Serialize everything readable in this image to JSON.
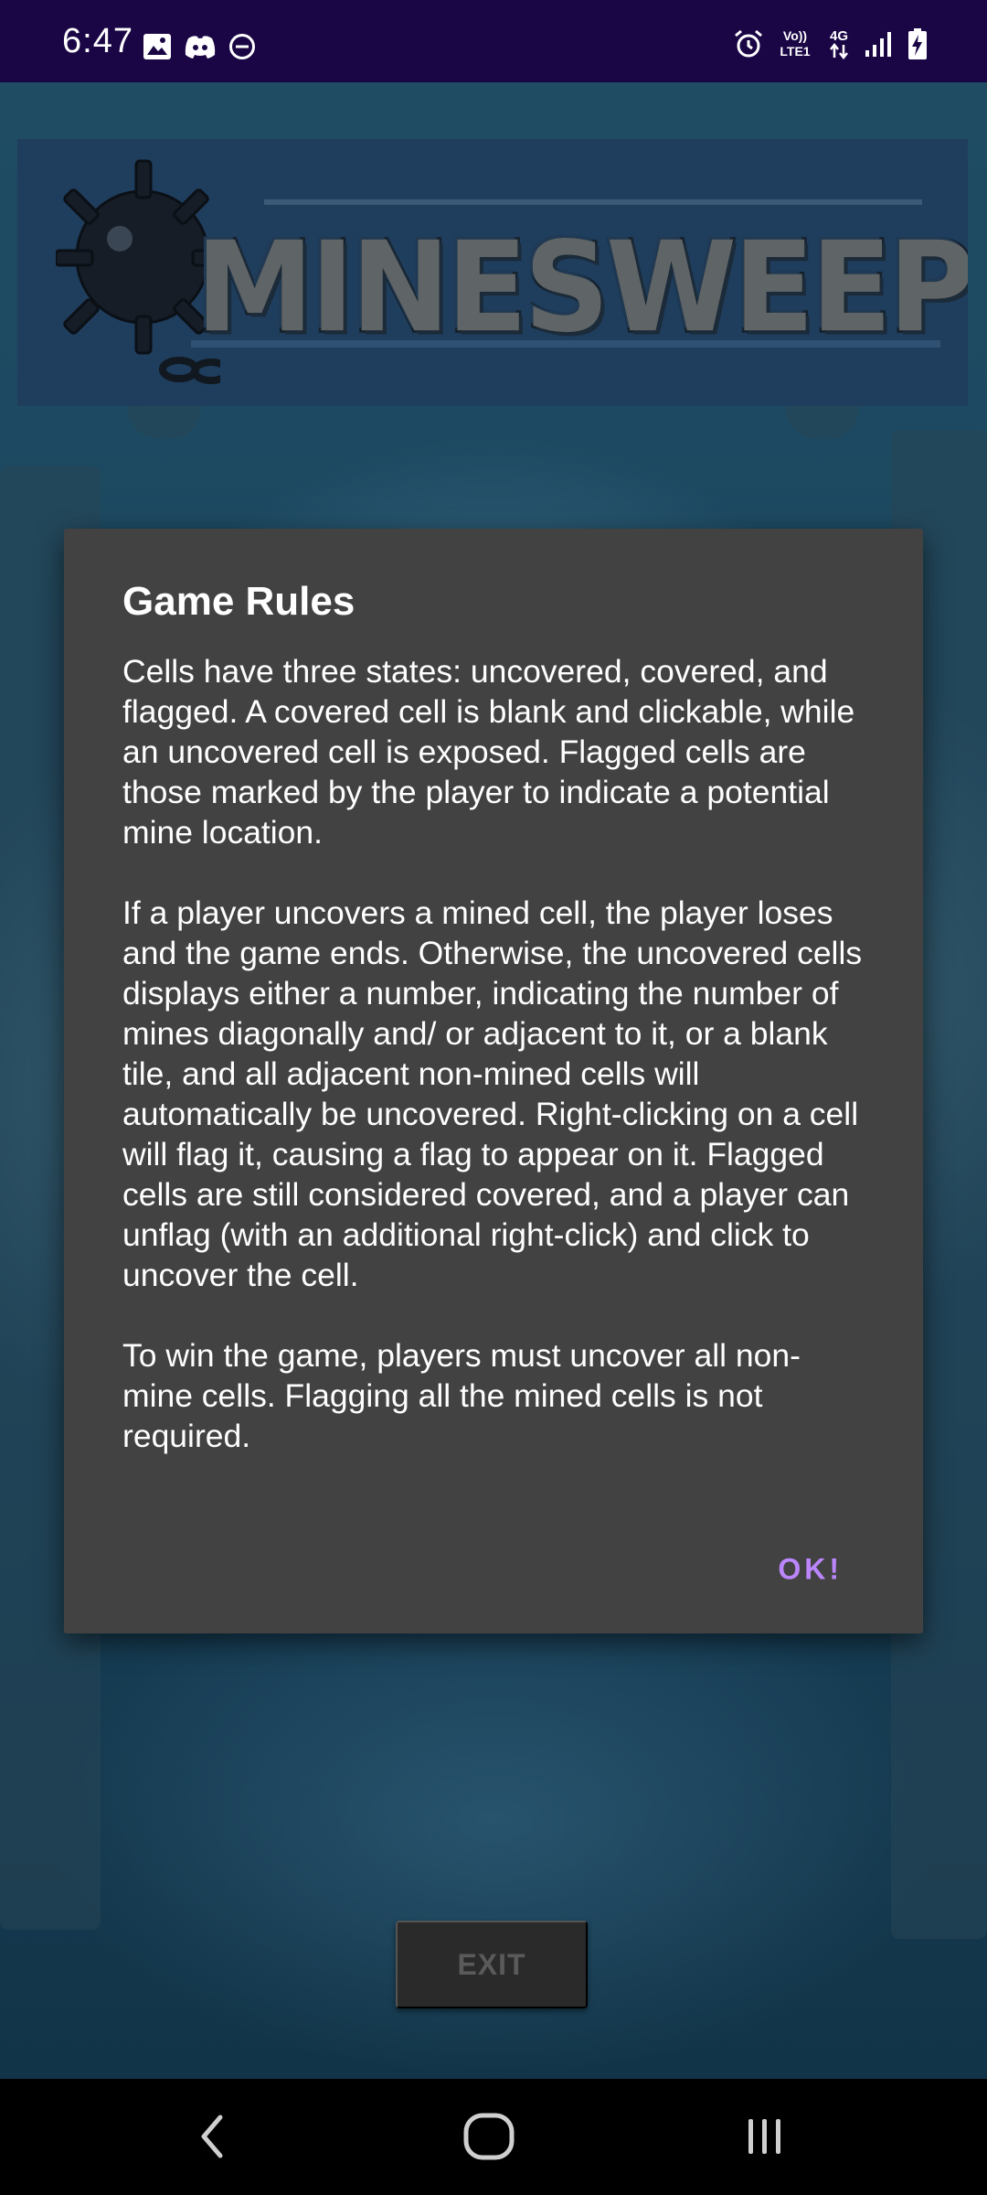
{
  "status_bar": {
    "time": "6:47",
    "left_icons": [
      "gallery-icon",
      "discord-icon",
      "do-not-disturb-icon"
    ],
    "right_icons": [
      "alarm-icon",
      "volte-icon",
      "4g-data-icon",
      "signal-icon",
      "battery-charging-icon"
    ],
    "volte_text": "Vo)) LTE1",
    "network_text": "4G"
  },
  "banner": {
    "title": "MINESWEEPER",
    "icon": "mine-icon"
  },
  "dialog": {
    "title": "Game Rules",
    "paragraphs": [
      "Cells have three states: uncovered, covered, and flagged. A covered cell is blank and clickable, while an uncovered cell is exposed. Flagged cells are those marked by the player to indicate a potential mine location.",
      "If a player uncovers a mined cell, the player loses and the game ends. Otherwise, the uncovered cells displays either a number, indicating the number of mines diagonally and/ or adjacent to it, or a blank tile, and all adjacent non-mined cells will automatically be uncovered. Right-clicking on a cell will flag it, causing a flag to appear on it. Flagged cells are still considered covered, and a player can unflag (with an additional right-click) and click to uncover the cell.",
      "To win the game, players must uncover all non-mine cells. Flagging all the mined cells is not required."
    ],
    "ok_label": "OK!"
  },
  "exit_button": {
    "label": "EXIT"
  },
  "nav_bar": {
    "icons": [
      "back-icon",
      "home-icon",
      "recents-icon"
    ]
  },
  "colors": {
    "status_bar_bg": "#1a0645",
    "dialog_bg": "#424242",
    "accent": "#bb86fc",
    "nav_bar_bg": "#000000"
  }
}
